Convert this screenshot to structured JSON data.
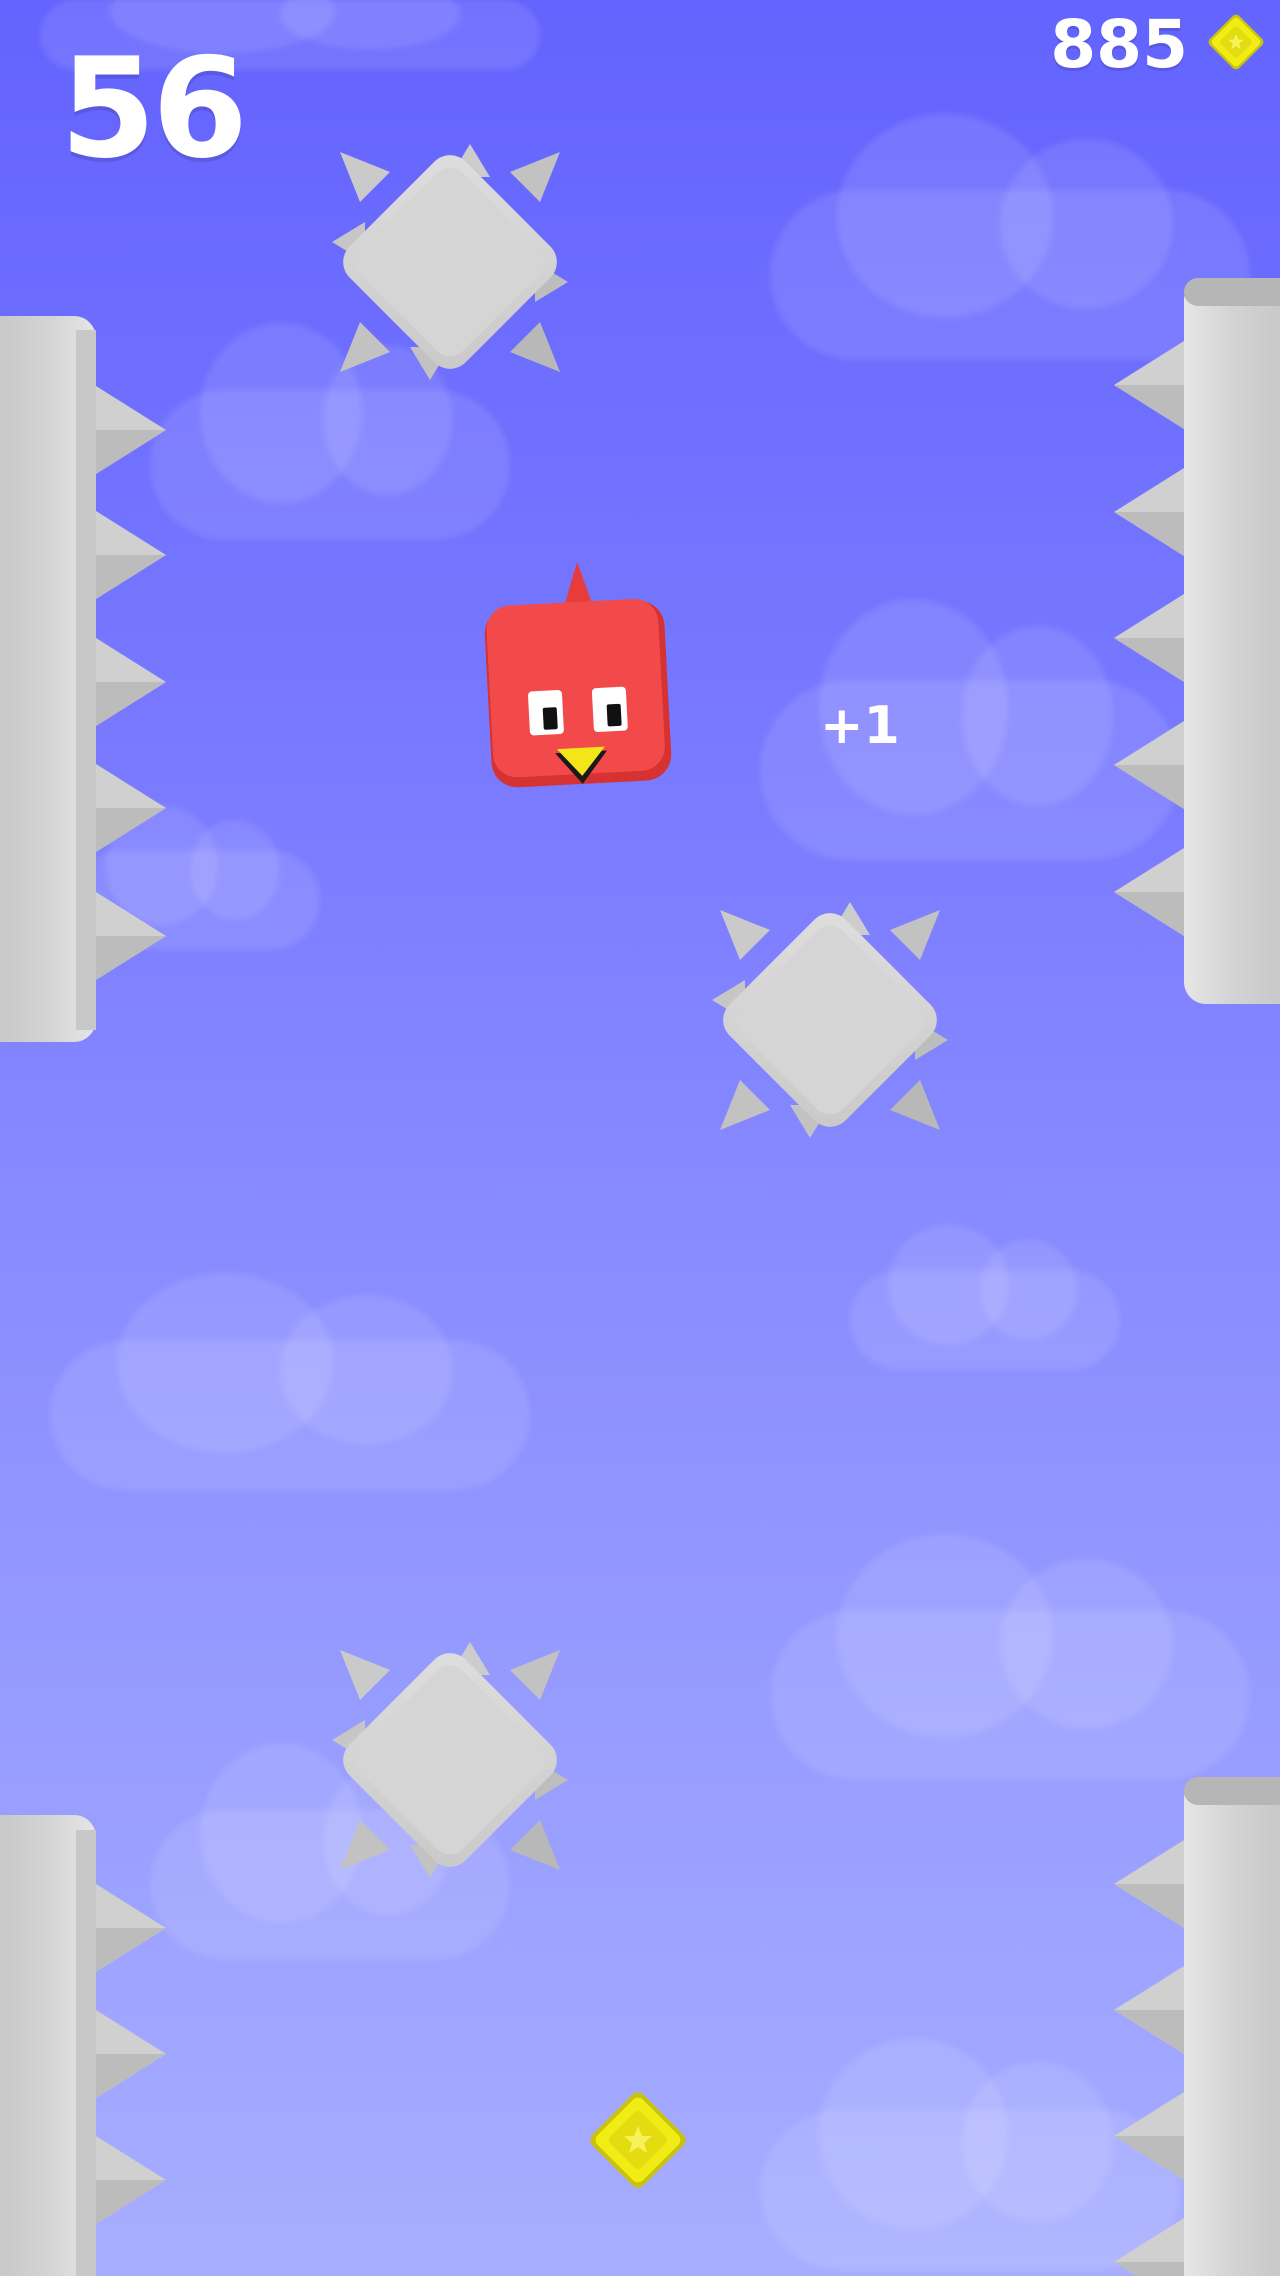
{
  "hud": {
    "score": "56",
    "coins": "885",
    "coin_icon": "yellow-star-gem-icon"
  },
  "popup": {
    "points_text": "+1"
  },
  "player": {
    "icon": "red-square-bird",
    "body_color": "#f24a4a",
    "beak_color": "#f2e61a"
  },
  "hazards": {
    "spike_wall_color": "#d0d0d0",
    "spiked_block_color": "#d6d6d6"
  },
  "pickups": {
    "gem_icon": "yellow-star-gem-icon",
    "gem_color": "#f0ec14"
  },
  "colors": {
    "sky_top": "#6363ff",
    "sky_bottom": "#a7aeff",
    "text": "#ffffff"
  }
}
